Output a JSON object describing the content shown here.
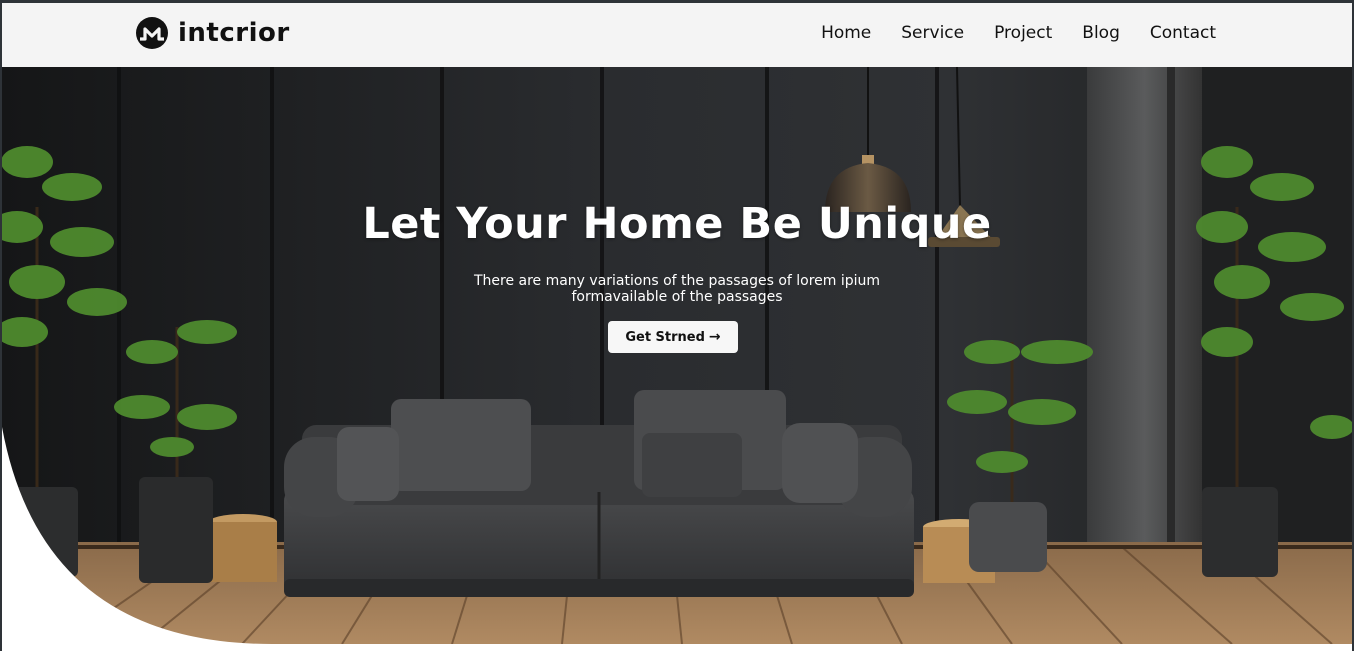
{
  "header": {
    "logo_text": "intcrior",
    "logo_icon": "monero-m-icon",
    "nav": [
      {
        "label": "Home"
      },
      {
        "label": "Service"
      },
      {
        "label": "Project"
      },
      {
        "label": "Blog"
      },
      {
        "label": "Contact"
      }
    ]
  },
  "hero": {
    "title": "Let Your Home Be Unique",
    "subtitle": "There are many variations of the passages of lorem ipium formavailable of the passages",
    "cta_label": "Get Strned",
    "cta_icon": "arrow-right-icon"
  },
  "colors": {
    "header_bg": "#f4f4f4",
    "hero_wall": "#1c1d1f",
    "button_bg": "#f7f7f7",
    "text_dark": "#111111",
    "text_light": "#ffffff"
  }
}
